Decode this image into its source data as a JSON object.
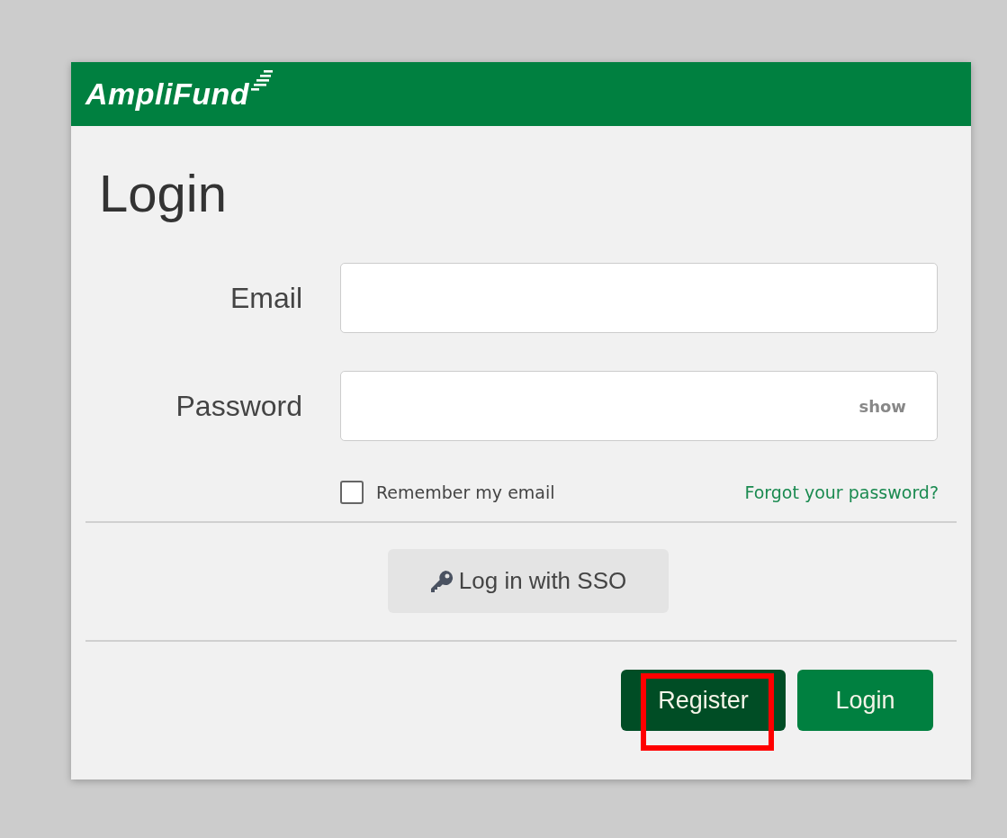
{
  "header": {
    "logo": "AmpliFund"
  },
  "title": "Login",
  "fields": [
    {
      "kind": "text",
      "label": "Email"
    },
    {
      "kind": "password",
      "label": "Password",
      "toggle": "show"
    }
  ],
  "remember": {
    "label": "Remember my email",
    "checked": false
  },
  "forgot_link": "Forgot your password?",
  "sso_button": "Log in with SSO",
  "buttons": [
    {
      "kind": "secondary",
      "label": "Register",
      "highlighted": true
    },
    {
      "kind": "primary",
      "label": "Login",
      "highlighted": false
    }
  ]
}
